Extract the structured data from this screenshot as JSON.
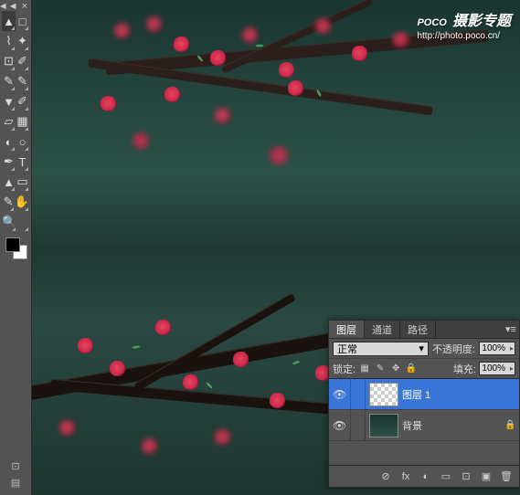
{
  "watermark": {
    "brand": "POCO",
    "tagline": "摄影专题",
    "url": "http://photo.poco.cn/"
  },
  "toolbar": {
    "collapse": "◄◄",
    "close": "×",
    "tools": [
      [
        "move",
        "▲"
      ],
      [
        "marquee",
        "□"
      ],
      [
        "lasso",
        "⌇"
      ],
      [
        "wand",
        "✦"
      ],
      [
        "crop",
        "⊡"
      ],
      [
        "eyedropper",
        "✐"
      ],
      [
        "healing",
        "✎"
      ],
      [
        "brush",
        "✎"
      ],
      [
        "stamp",
        "▼"
      ],
      [
        "history-brush",
        "✐"
      ],
      [
        "eraser",
        "▱"
      ],
      [
        "gradient",
        "▦"
      ],
      [
        "blur",
        "◐"
      ],
      [
        "dodge",
        "○"
      ],
      [
        "pen",
        "✒"
      ],
      [
        "type",
        "T"
      ],
      [
        "path-select",
        "▲"
      ],
      [
        "shape",
        "▭"
      ],
      [
        "notes",
        "✎"
      ],
      [
        "hand",
        "✋"
      ],
      [
        "zoom",
        "🔍"
      ],
      [
        "",
        ""
      ]
    ],
    "foot": [
      "⊡",
      "▤"
    ]
  },
  "panel": {
    "tabs": [
      "图层",
      "通道",
      "路径"
    ],
    "blend": "正常",
    "opacity_lbl": "不透明度:",
    "opacity_val": "100%",
    "lock_lbl": "锁定:",
    "fill_lbl": "填充:",
    "fill_val": "100%",
    "layers": [
      {
        "name": "图层 1",
        "thumb": "checker",
        "sel": true,
        "locked": false
      },
      {
        "name": "背景",
        "thumb": "img",
        "sel": false,
        "locked": true
      }
    ],
    "foot_icons": [
      "⊘",
      "fx",
      "◐",
      "▭",
      "⊡",
      "▣",
      "🗑"
    ]
  }
}
